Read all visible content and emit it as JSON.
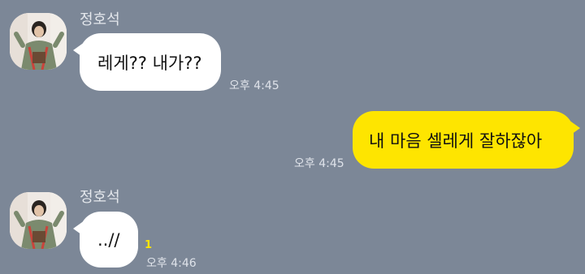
{
  "messages": [
    {
      "sender": "정호석",
      "text": "레게?? 내가??",
      "time": "오후 4:45",
      "side": "left",
      "avatar_icon": "profile-photo"
    },
    {
      "text": "내 마음 셀레게 잘하잖아",
      "time": "오후 4:45",
      "side": "right",
      "bubble_color": "#fee500"
    },
    {
      "sender": "정호석",
      "text": "..//",
      "time": "오후 4:46",
      "unread": "1",
      "side": "left",
      "avatar_icon": "profile-photo"
    }
  ],
  "colors": {
    "background": "#7c8797",
    "my_bubble": "#fee500",
    "their_bubble": "#ffffff",
    "unread": "#fee500"
  }
}
